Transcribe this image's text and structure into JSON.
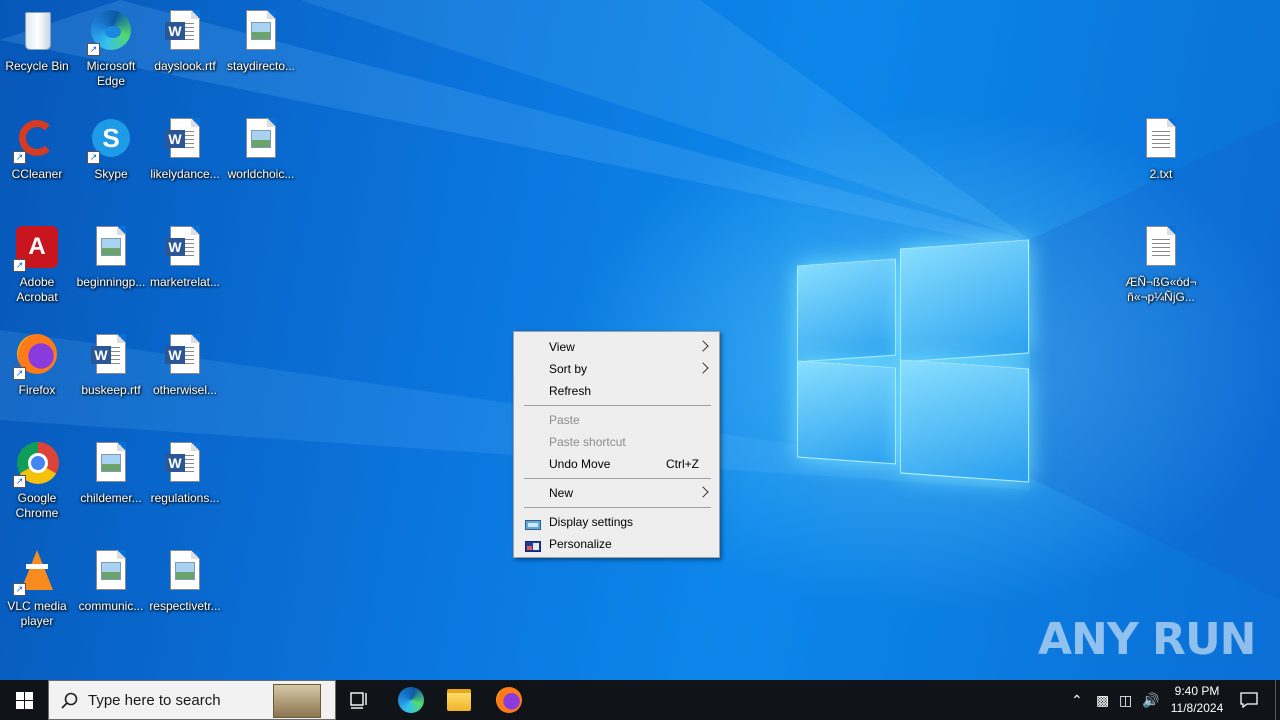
{
  "desktop_icons": {
    "recycle_bin": "Recycle Bin",
    "edge": "Microsoft Edge",
    "dayslook": "dayslook.rtf",
    "staydirecto": "staydirecto...",
    "ccleaner": "CCleaner",
    "skype": "Skype",
    "likelydance": "likelydance...",
    "worldchoic": "worldchoic...",
    "adobe": "Adobe Acrobat",
    "beginningp": "beginningp...",
    "marketrelat": "marketrelat...",
    "firefox": "Firefox",
    "buskeep": "buskeep.rtf",
    "otherwisel": "otherwisel...",
    "chrome": "Google Chrome",
    "childemer": "childemer...",
    "regulations": "regulations...",
    "vlc": "VLC media player",
    "communic": "communic...",
    "respectivetr": "respectivetr...",
    "two_txt": "2.txt",
    "garbled": "ÆÑ¬ßG«ód¬ ñ«¬p¼ÑjG..."
  },
  "context_menu": {
    "view": "View",
    "sort_by": "Sort by",
    "refresh": "Refresh",
    "paste": "Paste",
    "paste_shortcut": "Paste shortcut",
    "undo_move": "Undo Move",
    "undo_shortcut": "Ctrl+Z",
    "new": "New",
    "display_settings": "Display settings",
    "personalize": "Personalize"
  },
  "watermark": "ANY RUN",
  "taskbar": {
    "search_placeholder": "Type here to search",
    "time": "9:40 PM",
    "date": "11/8/2024"
  },
  "colors": {
    "taskbar": "#101418",
    "menu_bg": "#eeeeee",
    "wallpaper": "#0a74dc"
  }
}
